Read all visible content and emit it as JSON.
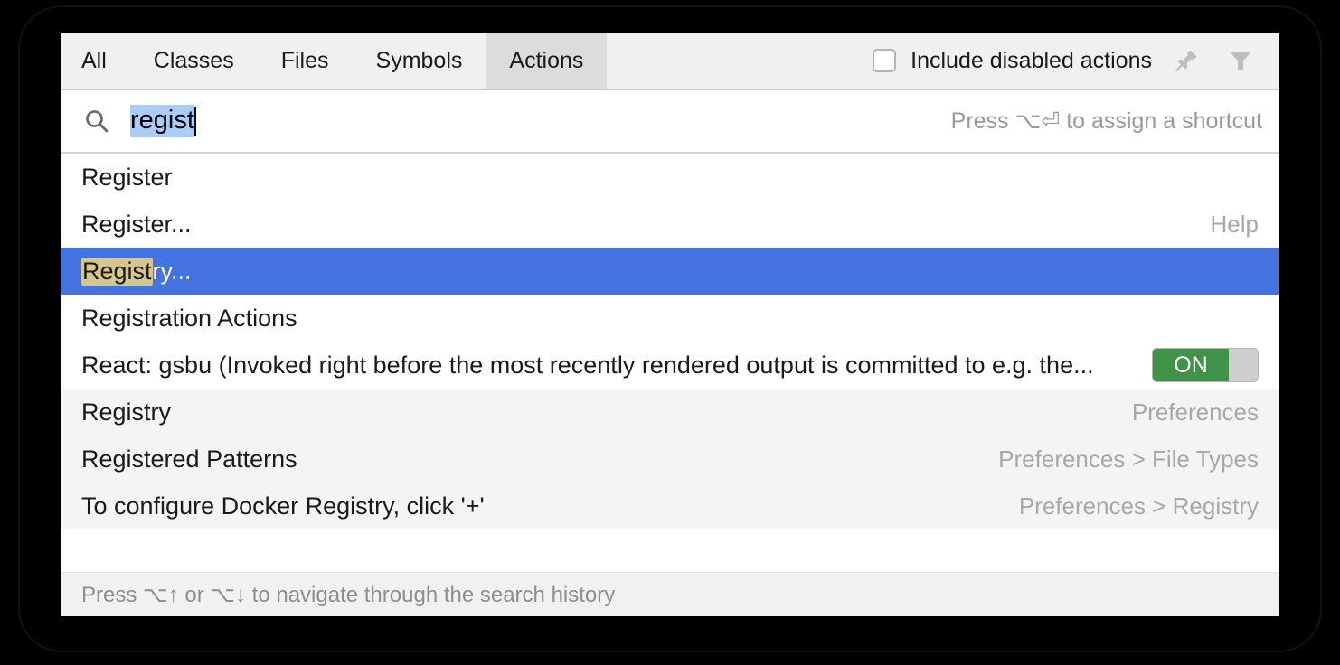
{
  "header": {
    "tabs": [
      {
        "label": "All",
        "active": false
      },
      {
        "label": "Classes",
        "active": false
      },
      {
        "label": "Files",
        "active": false
      },
      {
        "label": "Symbols",
        "active": false
      },
      {
        "label": "Actions",
        "active": true
      }
    ],
    "include_disabled_label": "Include disabled actions",
    "include_disabled_checked": false,
    "pin_icon": "pin-icon",
    "filter_icon": "filter-icon"
  },
  "search": {
    "icon": "search-icon",
    "value": "regist",
    "selected": true,
    "hint": "Press ⌥⏎ to assign a shortcut"
  },
  "results": [
    {
      "title": "Register",
      "match": "",
      "rest": "Register",
      "right": "",
      "shaded": false,
      "selected": false,
      "toggle": null
    },
    {
      "title": "Register...",
      "match": "",
      "rest": "Register...",
      "right": "Help",
      "shaded": false,
      "selected": false,
      "toggle": null
    },
    {
      "title": "Registry...",
      "match": "Regist",
      "rest": "ry...",
      "right": "",
      "shaded": false,
      "selected": true,
      "toggle": null
    },
    {
      "title": "Registration Actions",
      "match": "",
      "rest": "Registration Actions",
      "right": "",
      "shaded": false,
      "selected": false,
      "toggle": null
    },
    {
      "title": "React: gsbu (Invoked right before the most recently rendered output is committed to e.g. the...",
      "match": "",
      "rest": "React: gsbu (Invoked right before the most recently rendered output is committed to e.g. the...",
      "right": "",
      "shaded": false,
      "selected": false,
      "toggle": "ON"
    },
    {
      "title": "Registry",
      "match": "",
      "rest": "Registry",
      "right": "Preferences",
      "shaded": true,
      "selected": false,
      "toggle": null
    },
    {
      "title": "Registered Patterns",
      "match": "",
      "rest": "Registered Patterns",
      "right": "Preferences > File Types",
      "shaded": true,
      "selected": false,
      "toggle": null
    },
    {
      "title": "To configure Docker Registry, click '+'",
      "match": "",
      "rest": "To configure Docker Registry, click '+'",
      "right": "Preferences > Registry",
      "shaded": true,
      "selected": false,
      "toggle": null
    }
  ],
  "footer": {
    "text": "Press ⌥↑ or ⌥↓ to navigate through the search history"
  },
  "colors": {
    "selection_blue": "#4273e0",
    "match_highlight": "#d7c68c",
    "toggle_green": "#3f9246",
    "search_selection": "#aacdf7",
    "header_bg": "#f0f0f0",
    "active_tab_bg": "#dcdcdc",
    "shaded_row_bg": "#f4f4f4"
  }
}
